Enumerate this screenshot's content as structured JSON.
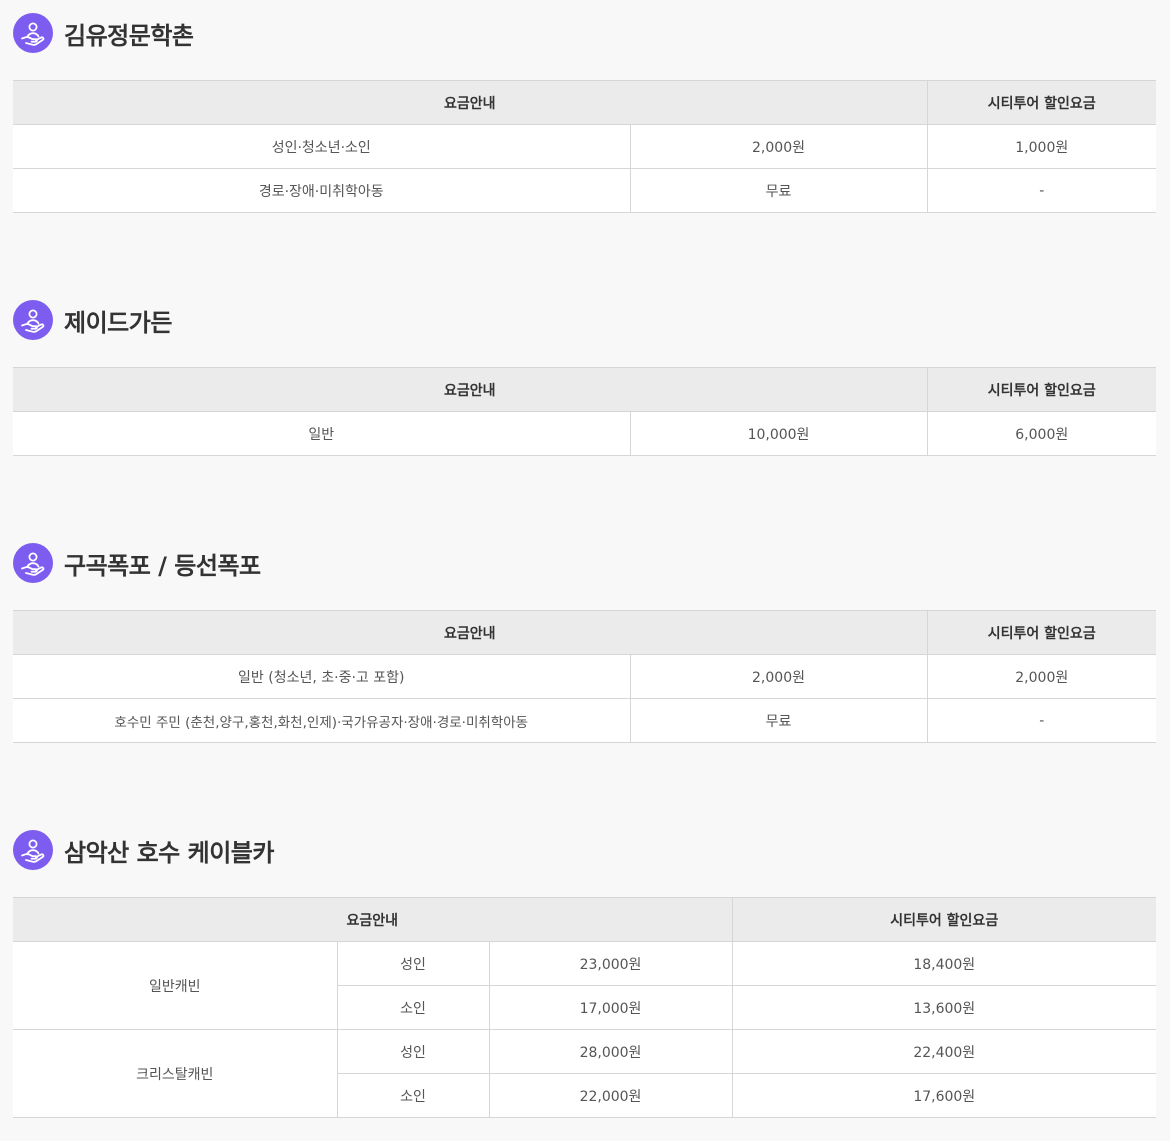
{
  "header_labels": {
    "fare_info": "요금안내",
    "city_tour_discount": "시티투어 할인요금"
  },
  "icons": {
    "section_icon": "hand-person-icon",
    "accent_color": "#7d5cf0"
  },
  "sections": [
    {
      "title": "김유정문학촌",
      "rows": [
        {
          "category": "성인·청소년·소인",
          "price": "2,000원",
          "discount": "1,000원"
        },
        {
          "category": "경로·장애·미취학아동",
          "price": "무료",
          "discount": "-"
        }
      ]
    },
    {
      "title": "제이드가든",
      "rows": [
        {
          "category": "일반",
          "price": "10,000원",
          "discount": "6,000원"
        }
      ]
    },
    {
      "title": "구곡폭포 / 등선폭포",
      "rows": [
        {
          "category": "일반 (청소년, 초·중·고 포함)",
          "price": "2,000원",
          "discount": "2,000원"
        },
        {
          "category": "호수민 주민 (춘천,양구,홍천,화천,인제)·국가유공자·장애·경로·미취학아동",
          "price": "무료",
          "discount": "-"
        }
      ]
    },
    {
      "title": "삼악산 호수 케이블카",
      "groups": [
        {
          "cabin": "일반캐빈",
          "rows": [
            {
              "age": "성인",
              "price": "23,000원",
              "discount": "18,400원"
            },
            {
              "age": "소인",
              "price": "17,000원",
              "discount": "13,600원"
            }
          ]
        },
        {
          "cabin": "크리스탈캐빈",
          "rows": [
            {
              "age": "성인",
              "price": "28,000원",
              "discount": "22,400원"
            },
            {
              "age": "소인",
              "price": "22,000원",
              "discount": "17,600원"
            }
          ]
        }
      ]
    }
  ]
}
